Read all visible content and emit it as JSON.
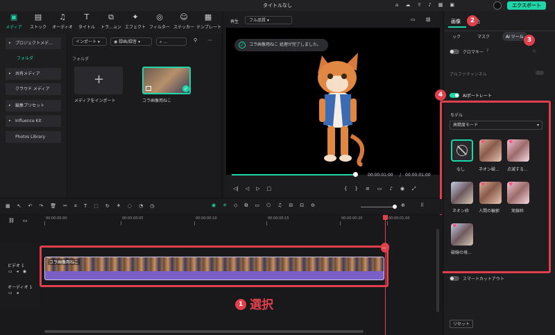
{
  "window": {
    "title": "タイトルなし",
    "export_label": "エクスポート"
  },
  "toolbar_tabs": [
    {
      "label": "メディア",
      "icon": "media-icon",
      "active": true
    },
    {
      "label": "ストック",
      "icon": "stock-icon"
    },
    {
      "label": "オーディオ",
      "icon": "music-icon"
    },
    {
      "label": "タイトル",
      "icon": "title-icon"
    },
    {
      "label": "トラ...ョン",
      "icon": "transition-icon"
    },
    {
      "label": "エフェクト",
      "icon": "effect-icon"
    },
    {
      "label": "フィルター",
      "icon": "filter-icon"
    },
    {
      "label": "ステッカー",
      "icon": "sticker-icon"
    },
    {
      "label": "テンプレート",
      "icon": "template-icon"
    }
  ],
  "sidebar": {
    "items": [
      "プロジェクトメデ...",
      "フォルダ",
      "共有メディア",
      "クラウド メディア",
      "編集プリセット",
      "Influence Kit",
      "Photos Library"
    ]
  },
  "media": {
    "import_label": "インポート",
    "record_label": "録画/録音",
    "folder_label": "フォルダ",
    "import_tile_label": "メディアをインポート",
    "clip_label": "コラ画像用ねこ"
  },
  "player": {
    "label": "再生",
    "quality": "フル品質",
    "toast": "コラ画像用ねこ 処理が完了しました。",
    "current_time": "00:00:01:00",
    "total_time": "00:00:01:00",
    "separator": "/"
  },
  "properties": {
    "tabs": [
      "画像",
      "色"
    ],
    "subtabs": [
      "ック",
      "マスク",
      "AI ツール"
    ],
    "chroma_key": "クロマキー",
    "alpha_channel": "アルファチャンネル",
    "ai_portrait": "AIポートレート",
    "model_heading": "モデル",
    "model_value": "高精度モード",
    "presets": [
      "なし",
      "ネオン破...",
      "点滅する...",
      "ネオン枠",
      "人間の輪郭",
      "実線枠",
      "破線の境..."
    ],
    "smart_cutout": "スマートカットアウト",
    "reset": "リセット"
  },
  "timeline": {
    "ruler": [
      "00:00:00:00",
      "00:00:00:05",
      "00:00:00:10",
      "00:00:00:15",
      "00:00:00:20",
      "00:00:01:00"
    ],
    "video_track": "ビデオ 1",
    "audio_track": "オーディオ 1",
    "clip_label": "コラ画像用ねこ",
    "playhead_badge": "0/5"
  },
  "annotations": {
    "step1": "1",
    "step1_text": "選択",
    "step2": "2",
    "step3": "3",
    "step4": "4"
  },
  "colors": {
    "accent": "#1ed6a8",
    "annotation": "#e0404b",
    "clip": "#7a5fc7"
  }
}
